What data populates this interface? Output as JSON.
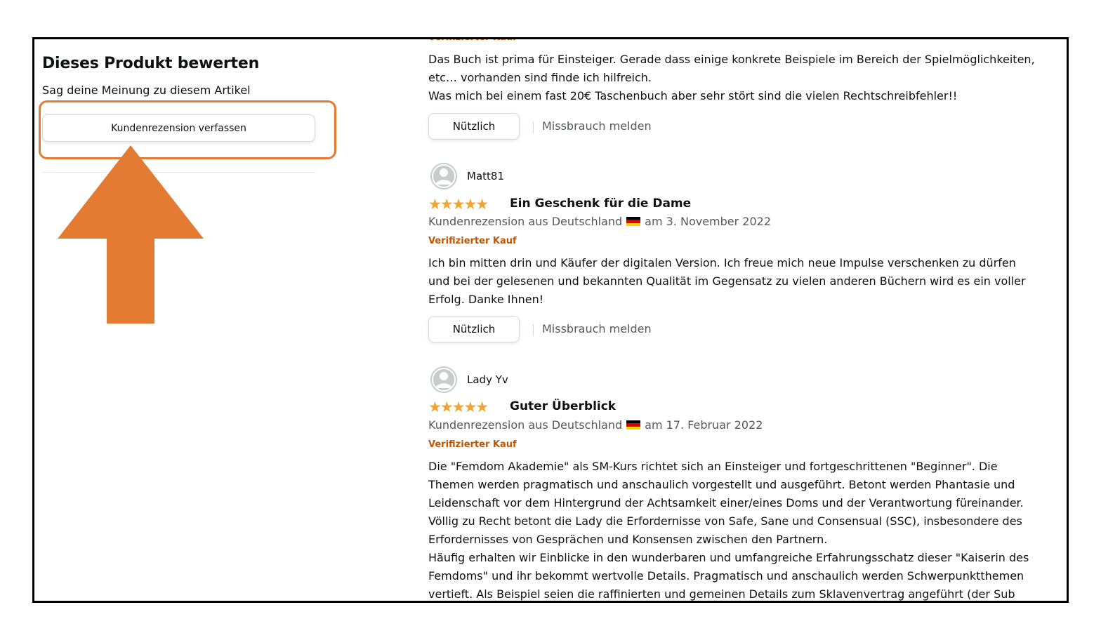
{
  "left": {
    "title": "Dieses Produkt bewerten",
    "subtitle": "Sag deine Meinung zu diesem Artikel",
    "write_review_label": "Kundenrezension verfassen"
  },
  "colors": {
    "highlight": "#e37b32",
    "stars": "#f0a431",
    "verified": "#c45500"
  },
  "reviews": [
    {
      "clipped_label": "Verifizierter Kauf",
      "lines": [
        "Das Buch ist prima für Einsteiger. Gerade dass einige konkrete Beispiele im Bereich der Spielmöglichkeiten,",
        "etc… vorhanden sind finde ich hilfreich.",
        "Was mich bei einem fast 20€ Taschenbuch aber sehr stört sind die vielen Rechtschreibfehler!!"
      ],
      "useful_label": "Nützlich",
      "report_label": "Missbrauch melden"
    },
    {
      "reviewer": "Matt81",
      "rating": 5,
      "title": "Ein Geschenk für die Dame",
      "meta_prefix": "Kundenrezension aus Deutschland",
      "meta_date": "am 3. November 2022",
      "verified": "Verifizierter Kauf",
      "lines": [
        "Ich bin mitten drin und Käufer der digitalen Version. Ich freue mich neue Impulse verschenken zu dürfen",
        "und bei der gelesenen und bekannten Qualität im Gegensatz zu vielen anderen Büchern wird es ein voller",
        "Erfolg. Danke Ihnen!"
      ],
      "useful_label": "Nützlich",
      "report_label": "Missbrauch melden"
    },
    {
      "reviewer": "Lady Yv",
      "rating": 5,
      "title": "Guter Überblick",
      "meta_prefix": "Kundenrezension aus Deutschland",
      "meta_date": "am 17. Februar 2022",
      "verified": "Verifizierter Kauf",
      "lines": [
        "Die \"Femdom Akademie\" als SM-Kurs richtet sich an Einsteiger und fortgeschrittenen \"Beginner\". Die",
        "Themen werden pragmatisch und anschaulich vorgestellt und ausgeführt. Betont werden Phantasie und",
        "Leidenschaft vor dem Hintergrund der Achtsamkeit einer/eines Doms und der Verantwortung füreinander.",
        "Völlig zu Recht betont die Lady die Erfordernisse von Safe, Sane und Consensual (SSC), insbesondere des",
        "Erfordernisses von Gesprächen und Konsensen zwischen den Partnern.",
        "Häufig erhalten wir Einblicke in den wunderbaren und umfangreiche Erfahrungsschatz dieser \"Kaiserin des",
        "Femdoms\" und ihr bekommt wertvolle Details. Pragmatisch und anschaulich werden Schwerpunktthemen",
        "vertieft. Als Beispiel seien die raffinierten und gemeinen Details zum Sklavenvertrag angeführt (der Sub"
      ]
    }
  ]
}
